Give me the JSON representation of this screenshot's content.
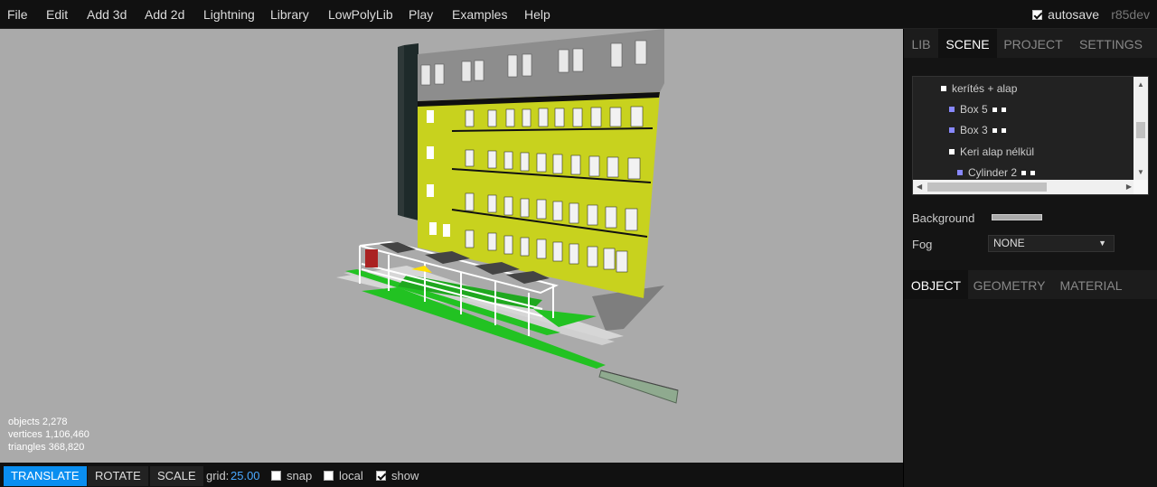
{
  "menu": [
    "File",
    "Edit",
    "Add 3d",
    "Add 2d",
    "Lightning",
    "Library",
    "LowPolyLib",
    "Play",
    "Examples",
    "Help"
  ],
  "autosave_label": "autosave",
  "version": "r85dev",
  "viewport": {
    "info_lines": [
      "objects  2,278",
      "vertices  1,106,460",
      "triangles  368,820"
    ]
  },
  "toolbar": {
    "translate": "TRANSLATE",
    "rotate": "ROTATE",
    "scale": "SCALE",
    "grid_label": "grid:",
    "grid_value": "25.00",
    "snap": "snap",
    "local": "local",
    "show": "show"
  },
  "sidebar": {
    "top_tabs": [
      "LIB",
      "SCENE",
      "PROJECT",
      "SETTINGS"
    ],
    "outliner": [
      {
        "label": "kerítés + alap",
        "dot_color": "#ffffff",
        "trail": 0
      },
      {
        "label": "Box 5",
        "dot_color": "#8888ff",
        "trail": 2
      },
      {
        "label": "Box 3",
        "dot_color": "#8888ff",
        "trail": 2
      },
      {
        "label": "Keri alap nélkül",
        "dot_color": "#ffffff",
        "trail": 0
      },
      {
        "label": "Cylinder 2",
        "dot_color": "#8888ff",
        "trail": 2
      }
    ],
    "background_label": "Background",
    "fog_label": "Fog",
    "fog_value": "NONE",
    "bottom_tabs": [
      "OBJECT",
      "GEOMETRY",
      "MATERIAL"
    ]
  },
  "colors": {
    "accent": "#0a8ef0",
    "viewport_bg": "#aaaaaa",
    "facade": "#c8d21e"
  }
}
